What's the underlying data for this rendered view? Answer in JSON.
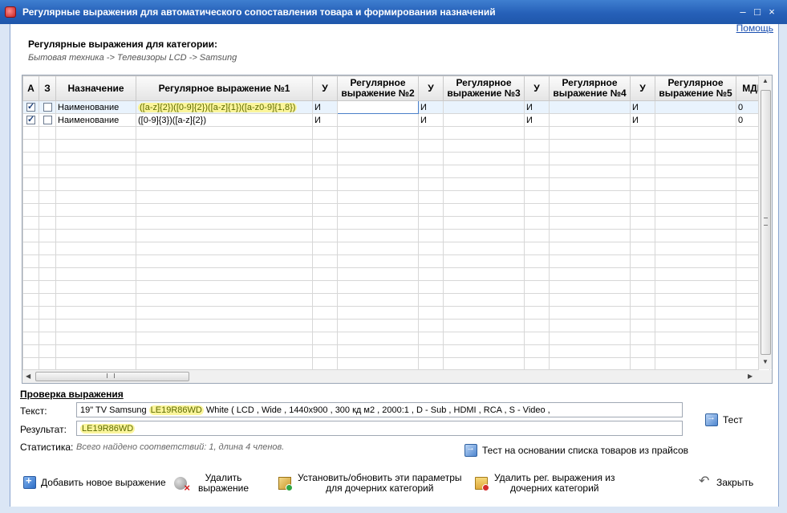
{
  "window": {
    "title": "Регулярные выражения для автоматического сопоставления товара и формирования назначений"
  },
  "help_link": "Помощь",
  "category": {
    "title": "Регулярные выражения для категории:",
    "path": "Бытовая техника -> Телевизоры LCD -> Samsung"
  },
  "grid": {
    "cols": [
      "А",
      "З",
      "Назначение",
      "Регулярное выражение №1",
      "У",
      "Регулярное выражение №2",
      "У",
      "Регулярное выражение №3",
      "У",
      "Регулярное выражение №4",
      "У",
      "Регулярное выражение №5",
      "МДЕ"
    ],
    "rows": [
      {
        "a": true,
        "z": false,
        "naznachenie": "Наименование",
        "rx1": "([a-z]{2})([0-9]{2})([a-z]{1})([a-z0-9]{1,8})",
        "u1": "И",
        "rx2": "",
        "u2": "И",
        "rx3": "",
        "u3": "И",
        "rx4": "",
        "u4": "И",
        "rx5": "",
        "mde": "0"
      },
      {
        "a": true,
        "z": false,
        "naznachenie": "Наименование",
        "rx1": "([0-9]{3})([a-z]{2})",
        "u1": "И",
        "rx2": "",
        "u2": "И",
        "rx3": "",
        "u3": "И",
        "rx4": "",
        "u4": "И",
        "rx5": "",
        "mde": "0"
      }
    ]
  },
  "check": {
    "section_title": "Проверка выражения",
    "text_label": "Текст:",
    "text_before": "19\" TV Samsung ",
    "text_match": "LE19R86WD",
    "text_after": " White ( LCD , Wide , 1440x900 , 300 кд м2 , 2000:1 , D - Sub , HDMI , RCA , S - Video ,",
    "result_label": "Результат:",
    "result_value": "LE19R86WD",
    "stats_label": "Статистика:",
    "stats_value": "Всего найдено соответствий: 1, длина 4 членов.",
    "test_button": "Тест",
    "test_prices_button": "Тест на основании списка товаров из прайсов"
  },
  "buttons": {
    "add": "Добавить новое выражение",
    "delete_l1": "Удалить",
    "delete_l2": "выражение",
    "set_l1": "Установить/обновить эти параметры",
    "set_l2": "для дочерних категорий",
    "del_child_l1": "Удалить рег. выражения из",
    "del_child_l2": "дочерних категорий",
    "close": "Закрыть"
  }
}
